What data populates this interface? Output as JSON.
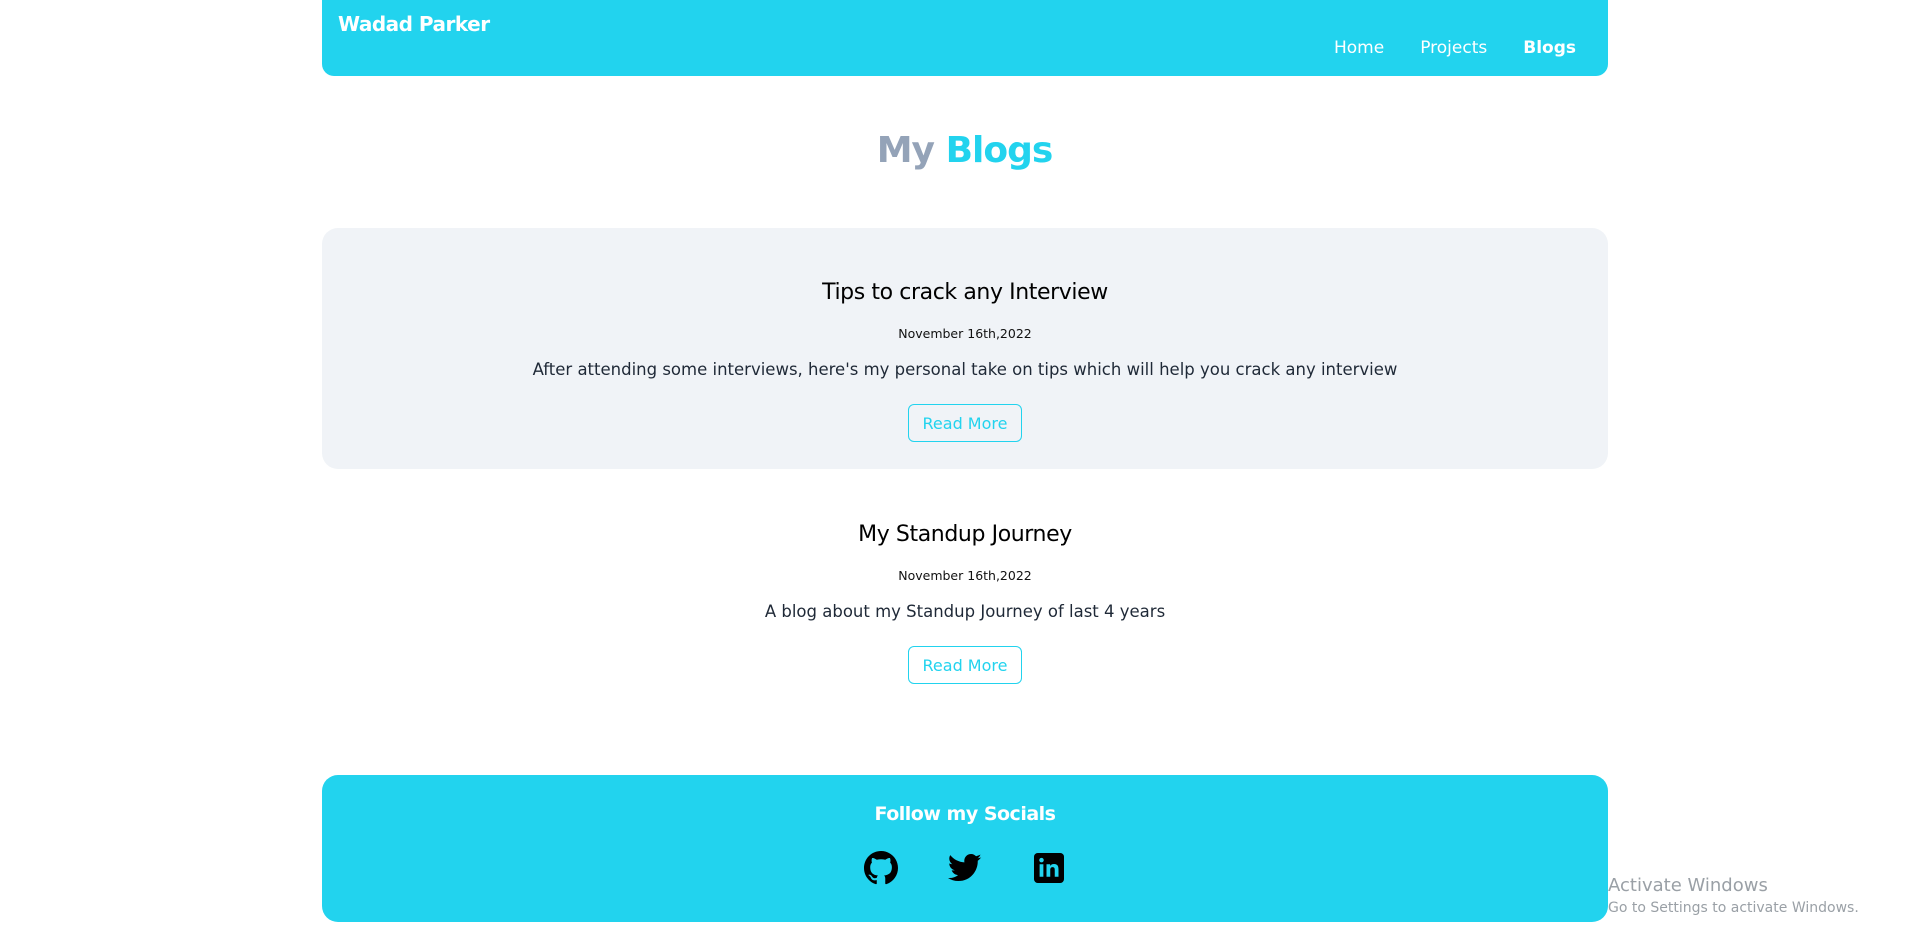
{
  "header": {
    "brand": "Wadad Parker",
    "nav": [
      {
        "label": "Home",
        "active": false
      },
      {
        "label": "Projects",
        "active": false
      },
      {
        "label": "Blogs",
        "active": true
      }
    ]
  },
  "page_title": {
    "muted": "My",
    "accent": "Blogs"
  },
  "blogs": [
    {
      "title": "Tips to crack any Interview",
      "date": "November 16th,2022",
      "description": "After attending some interviews, here's my personal take on tips which will help you crack any interview",
      "button": "Read More"
    },
    {
      "title": "My Standup Journey",
      "date": "November 16th,2022",
      "description": "A blog about my Standup Journey of last 4 years",
      "button": "Read More"
    }
  ],
  "footer": {
    "title": "Follow my Socials",
    "socials": [
      "github-icon",
      "twitter-icon",
      "linkedin-icon"
    ]
  },
  "watermark": {
    "title": "Activate Windows",
    "subtitle": "Go to Settings to activate Windows."
  },
  "colors": {
    "accent": "#22d3ee",
    "muted": "#94a3b8",
    "card_bg": "#f0f3f7"
  }
}
